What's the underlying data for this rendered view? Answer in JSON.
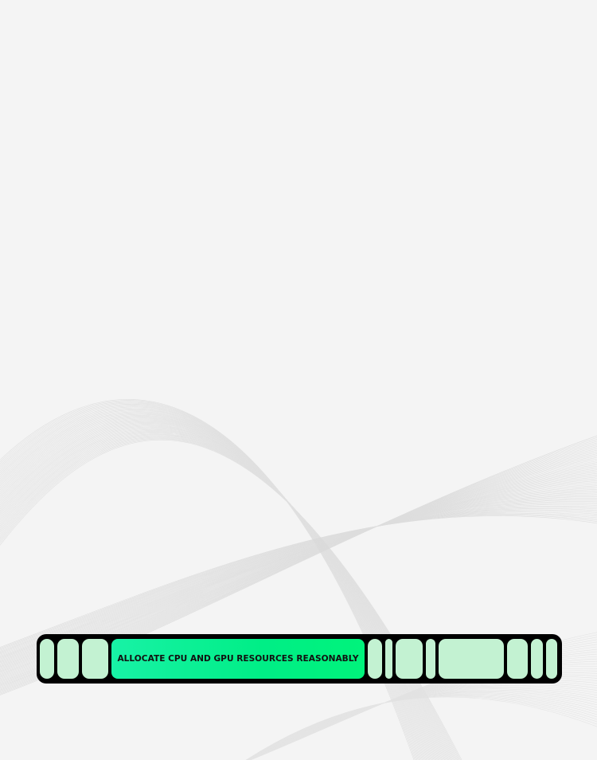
{
  "background": {
    "color": "#f4f4f4",
    "pattern": "gray wave line ribbons"
  },
  "progress_bar": {
    "label": "ALLOCATE CPU AND GPU RESOURCES REASONABLY",
    "frame_color": "#000000",
    "segment_color": "#c3f2d2",
    "active_color": "#00ee86",
    "segment_count": 12
  }
}
